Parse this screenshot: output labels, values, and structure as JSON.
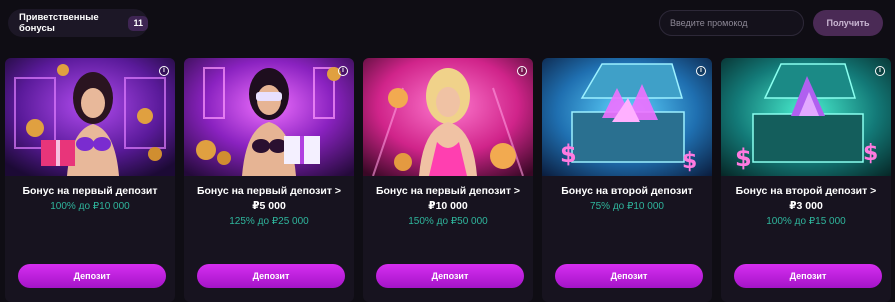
{
  "header": {
    "bonus_pill_label": "Приветственные бонусы",
    "bonus_count": "11",
    "promo_placeholder": "Введите промокод",
    "promo_submit_label": "Получить"
  },
  "cards": [
    {
      "title_line1": "Бонус на первый депозит",
      "title_line2": "",
      "offer": "100% до ₽10 000",
      "button_label": "Депозит",
      "info_icon": "i",
      "image": "woman-with-gift-purple-neon"
    },
    {
      "title_line1": "Бонус на первый депозит >",
      "title_line2": "₽5 000",
      "offer": "125% до ₽25 000",
      "button_label": "Депозит",
      "info_icon": "i",
      "image": "woman-with-vr-glasses-and-gift"
    },
    {
      "title_line1": "Бонус на первый депозит >",
      "title_line2": "₽10 000",
      "offer": "150% до ₽50 000",
      "button_label": "Депозит",
      "info_icon": "i",
      "image": "blonde-woman-pink-neon"
    },
    {
      "title_line1": "Бонус на второй депозит",
      "title_line2": "",
      "offer": "75% до ₽10 000",
      "button_label": "Депозит",
      "info_icon": "i",
      "image": "treasure-chest-with-crystals-blue"
    },
    {
      "title_line1": "Бонус на второй депозит >",
      "title_line2": "₽3 000",
      "offer": "100% до ₽15 000",
      "button_label": "Депозит",
      "info_icon": "i",
      "image": "treasure-chest-with-crystals-teal"
    }
  ],
  "colors": {
    "background": "#0f0d14",
    "card": "#17131f",
    "accent": "#c41fe6",
    "offer_text": "#2fb59c"
  }
}
